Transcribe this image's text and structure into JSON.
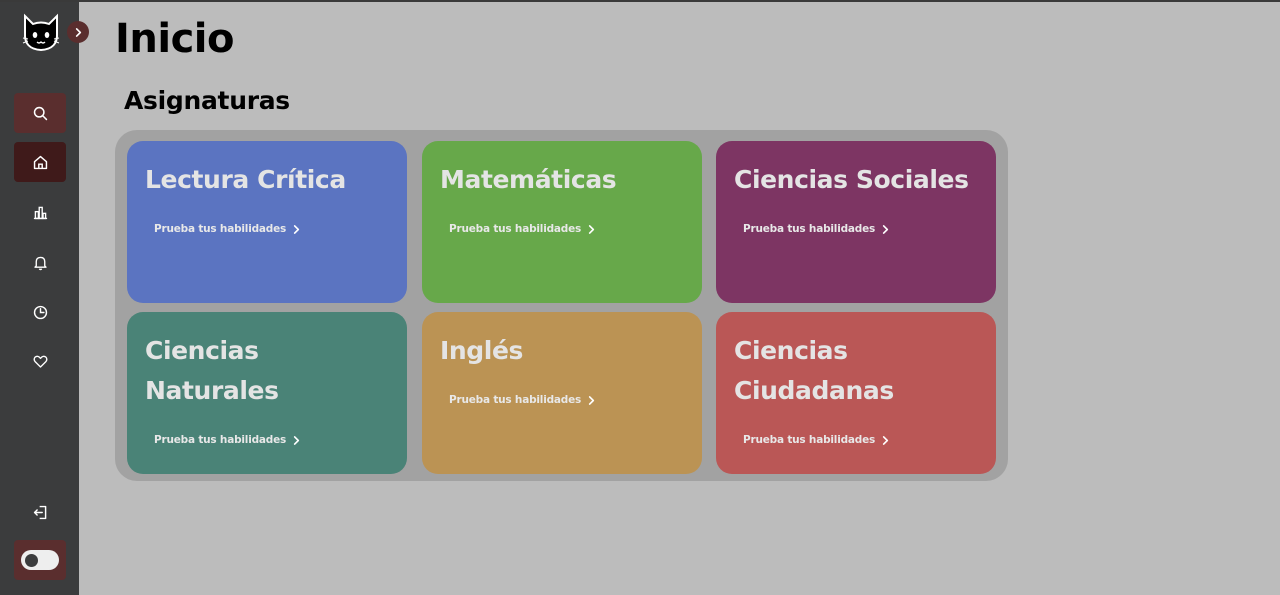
{
  "sidebar": {
    "logo_icon": "cat-logo-icon",
    "items": [
      {
        "name": "search",
        "icon": "search-icon"
      },
      {
        "name": "home",
        "icon": "home-icon",
        "active": true
      },
      {
        "name": "stats",
        "icon": "bar-chart-icon"
      },
      {
        "name": "notifications",
        "icon": "bell-icon"
      },
      {
        "name": "history",
        "icon": "clock-icon"
      },
      {
        "name": "favorites",
        "icon": "heart-icon"
      }
    ],
    "logout_icon": "logout-icon",
    "theme_toggle_icon": "toggle-icon"
  },
  "header": {
    "title": "Inicio"
  },
  "subjects": {
    "title": "Asignaturas",
    "cards": [
      {
        "title": "Lectura Crítica",
        "link": "Prueba tus habilidades",
        "color": "#5b74c1"
      },
      {
        "title": "Matemáticas",
        "link": "Prueba tus habilidades",
        "color": "#67a84a"
      },
      {
        "title": "Ciencias Sociales",
        "link": "Prueba tus habilidades",
        "color": "#7d3563"
      },
      {
        "title": "Ciencias Naturales",
        "link": "Prueba tus habilidades",
        "color": "#4a8377"
      },
      {
        "title": "Inglés",
        "link": "Prueba tus habilidades",
        "color": "#bb9354"
      },
      {
        "title": "Ciencias Ciudadanas",
        "link": "Prueba tus habilidades",
        "color": "#ba5756"
      }
    ]
  },
  "colors": {
    "sidebar_bg": "#3b3c3d",
    "accent": "#5a2e2e",
    "accent_active": "#3f1a1a",
    "page_bg": "#bcbcbc"
  }
}
